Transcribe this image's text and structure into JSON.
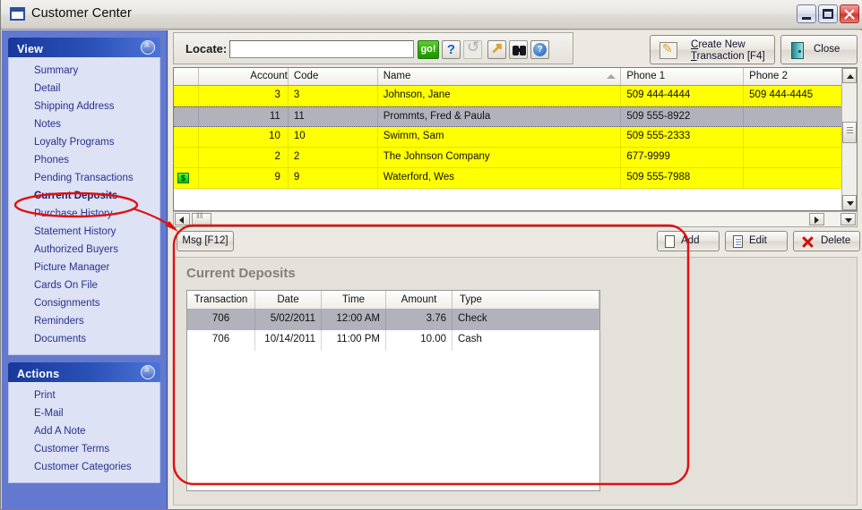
{
  "window": {
    "title": "Customer Center",
    "icon": "window-icon",
    "controls": {
      "minimize": "minimize",
      "maximize": "maximize",
      "close": "close"
    }
  },
  "sidebar": {
    "view_panel": {
      "title": "View",
      "collapse_icon": "chevron-up-icon",
      "items": [
        {
          "label": "Summary",
          "active": false
        },
        {
          "label": "Detail",
          "active": false
        },
        {
          "label": "Shipping Address",
          "active": false
        },
        {
          "label": "Notes",
          "active": false
        },
        {
          "label": "Loyalty Programs",
          "active": false
        },
        {
          "label": "Phones",
          "active": false
        },
        {
          "label": "Pending Transactions",
          "active": false
        },
        {
          "label": "Current Deposits",
          "active": true
        },
        {
          "label": "Purchase History",
          "active": false
        },
        {
          "label": "Statement History",
          "active": false
        },
        {
          "label": "Authorized Buyers",
          "active": false
        },
        {
          "label": "Picture Manager",
          "active": false
        },
        {
          "label": "Cards On File",
          "active": false
        },
        {
          "label": "Consignments",
          "active": false
        },
        {
          "label": "Reminders",
          "active": false
        },
        {
          "label": "Documents",
          "active": false
        }
      ]
    },
    "actions_panel": {
      "title": "Actions",
      "collapse_icon": "chevron-up-icon",
      "items": [
        {
          "label": "Print"
        },
        {
          "label": "E-Mail"
        },
        {
          "label": "Add A Note"
        },
        {
          "label": "Customer Terms"
        },
        {
          "label": "Customer Categories"
        }
      ]
    }
  },
  "toolbar": {
    "locate_label": "Locate:",
    "locate_value": "",
    "locate_placeholder": "",
    "go_label": "go!",
    "question_label": "?",
    "help_label": "?",
    "icons": [
      "go-button",
      "question-icon",
      "refresh-icon",
      "jump-arrow-icon",
      "binoculars-icon",
      "help-icon"
    ],
    "create_new_line1": "Create New",
    "create_new_line2": "Transaction [F4]",
    "create_new_accel1": "C",
    "create_new_accel2": "T",
    "close_label": "Close"
  },
  "customer_grid": {
    "columns": [
      "Account",
      "Code",
      "Name",
      "Phone 1",
      "Phone 2"
    ],
    "sort_column": "Name",
    "sort_direction": "ascending",
    "rows": [
      {
        "flag": "",
        "account": "3",
        "code": "3",
        "name": "Johnson, Jane",
        "phone1": "509  444-4444",
        "phone2": "509  444-4445",
        "selected": false
      },
      {
        "flag": "",
        "account": "11",
        "code": "11",
        "name": "Prommts, Fred & Paula",
        "phone1": "509  555-8922",
        "phone2": "",
        "selected": true
      },
      {
        "flag": "",
        "account": "10",
        "code": "10",
        "name": "Swimm, Sam",
        "phone1": "509  555-2333",
        "phone2": "",
        "selected": false
      },
      {
        "flag": "",
        "account": "2",
        "code": "2",
        "name": "The Johnson Company",
        "phone1": "677-9999",
        "phone2": "",
        "selected": false
      },
      {
        "flag": "$",
        "account": "9",
        "code": "9",
        "name": "Waterford, Wes",
        "phone1": "509  555-7988",
        "phone2": "",
        "selected": false
      }
    ]
  },
  "record_buttons": {
    "msg_label": "Msg [F12]",
    "add_label": "Add",
    "edit_label": "Edit",
    "delete_label": "Delete"
  },
  "deposits": {
    "title": "Current Deposits",
    "columns": [
      "Transaction",
      "Date",
      "Time",
      "Amount",
      "Type"
    ],
    "rows": [
      {
        "transaction": "706",
        "date": "5/02/2011",
        "time": "12:00 AM",
        "amount": "3.76",
        "type": "Check",
        "selected": true
      },
      {
        "transaction": "706",
        "date": "10/14/2011",
        "time": "11:00 PM",
        "amount": "10.00",
        "type": "Cash",
        "selected": false
      }
    ]
  },
  "annotations": {
    "highlight_color": "#e01010",
    "ellipse_target": "Current Deposits",
    "box_target": "Current Deposits panel"
  }
}
